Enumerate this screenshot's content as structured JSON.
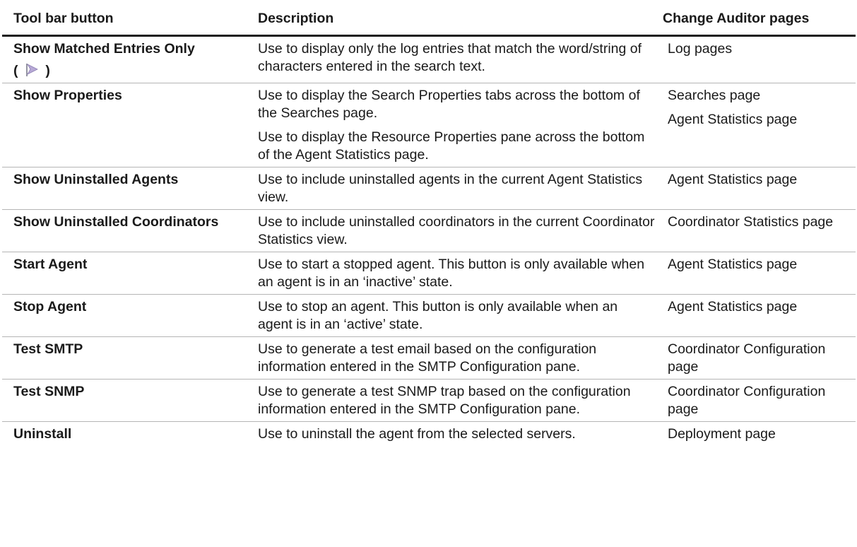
{
  "headers": {
    "col1": "Tool bar button",
    "col2": "Description",
    "col3": "Change Auditor pages"
  },
  "icons": {
    "show_matched_entries": "flag-arrow-icon"
  },
  "rows": [
    {
      "name": "Show Matched Entries Only",
      "name_suffix_open": "(",
      "name_suffix_close": ")",
      "desc": [
        "Use to display only the log entries that match the word/string of characters entered in the search text."
      ],
      "pages": [
        "Log pages"
      ]
    },
    {
      "name": "Show Properties",
      "desc": [
        "Use to display the Search Properties tabs across the bottom of the Searches page.",
        "Use to display the Resource Properties pane across the bottom of the Agent Statistics page."
      ],
      "pages": [
        "Searches page",
        "Agent Statistics page"
      ]
    },
    {
      "name": "Show Uninstalled Agents",
      "desc": [
        "Use to include uninstalled agents in the current Agent Statistics view."
      ],
      "pages": [
        "Agent Statistics page"
      ]
    },
    {
      "name": "Show Uninstalled Coordinators",
      "desc": [
        "Use to include uninstalled coordinators in the current Coordinator Statistics view."
      ],
      "pages": [
        "Coordinator Statistics page"
      ]
    },
    {
      "name": "Start Agent",
      "desc": [
        "Use to start a stopped agent. This button is only available when an agent is in an ‘inactive’ state."
      ],
      "pages": [
        "Agent Statistics page"
      ]
    },
    {
      "name": "Stop Agent",
      "desc": [
        "Use to stop an agent. This button is only available when an agent is in an ‘active’ state."
      ],
      "pages": [
        "Agent Statistics page"
      ]
    },
    {
      "name": "Test SMTP",
      "desc": [
        "Use to generate a test email based on the configuration information entered in the SMTP Configuration pane."
      ],
      "pages": [
        "Coordinator Configuration page"
      ]
    },
    {
      "name": "Test SNMP",
      "desc": [
        "Use to generate a test SNMP trap based on the configuration information entered in the SMTP Configuration pane."
      ],
      "pages": [
        "Coordinator Configuration page"
      ]
    },
    {
      "name": "Uninstall",
      "desc": [
        "Use to uninstall the agent from the selected servers."
      ],
      "pages": [
        "Deployment page"
      ]
    }
  ]
}
